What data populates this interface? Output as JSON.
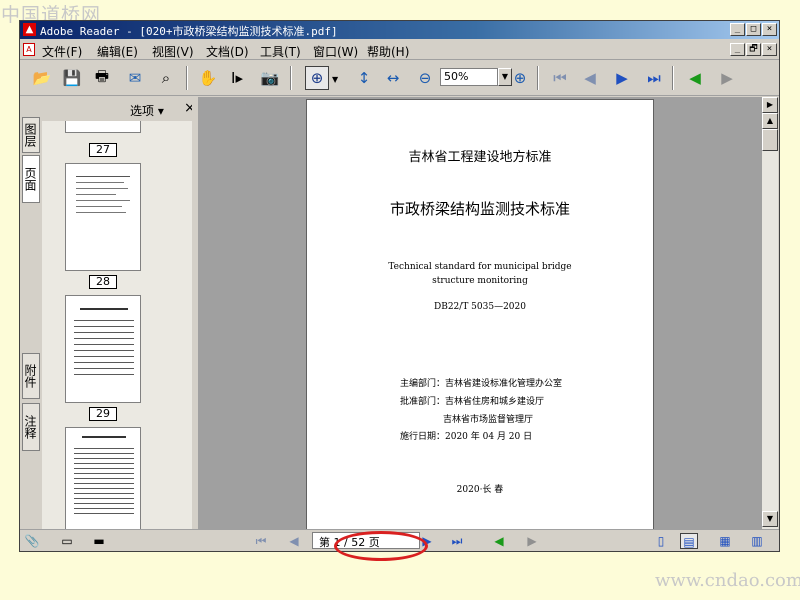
{
  "watermark_top": "中国道桥网",
  "watermark_bottom": "www.cndao.com",
  "window": {
    "title": "Adobe Reader - [020+市政桥梁结构监测技术标准.pdf]",
    "min": "_",
    "max": "□",
    "close": "×",
    "restore": "🗗"
  },
  "menu": [
    "文件(F)",
    "编辑(E)",
    "视图(V)",
    "文档(D)",
    "工具(T)",
    "窗口(W)",
    "帮助(H)"
  ],
  "toolbar": {
    "zoom_value": "50%"
  },
  "vtabs": [
    "图层",
    "页面",
    "附件",
    "注释"
  ],
  "panel": {
    "options_label": "选项 ▾",
    "close_label": "×"
  },
  "thumbnails": [
    "27",
    "28",
    "29"
  ],
  "document": {
    "header": "吉林省工程建设地方标准",
    "title": "市政桥梁结构监测技术标准",
    "english_line1": "Technical standard for municipal bridge",
    "english_line2": "structure monitoring",
    "code": "DB22/T 5035—2020",
    "info1": "主编部门：吉林省建设标准化管理办公室",
    "info2": "批准部门：吉林省住房和城乡建设厅",
    "info3": "吉林省市场监督管理厅",
    "info4": "施行日期：2020 年 04 月 20 日",
    "footer": "2020·长 春"
  },
  "status": {
    "page_indicator": "第 1 / 52 页"
  },
  "colors": {
    "accent_red": "#d92020",
    "title_blue": "#0a246a",
    "page_bg": "#a0a0a0"
  }
}
